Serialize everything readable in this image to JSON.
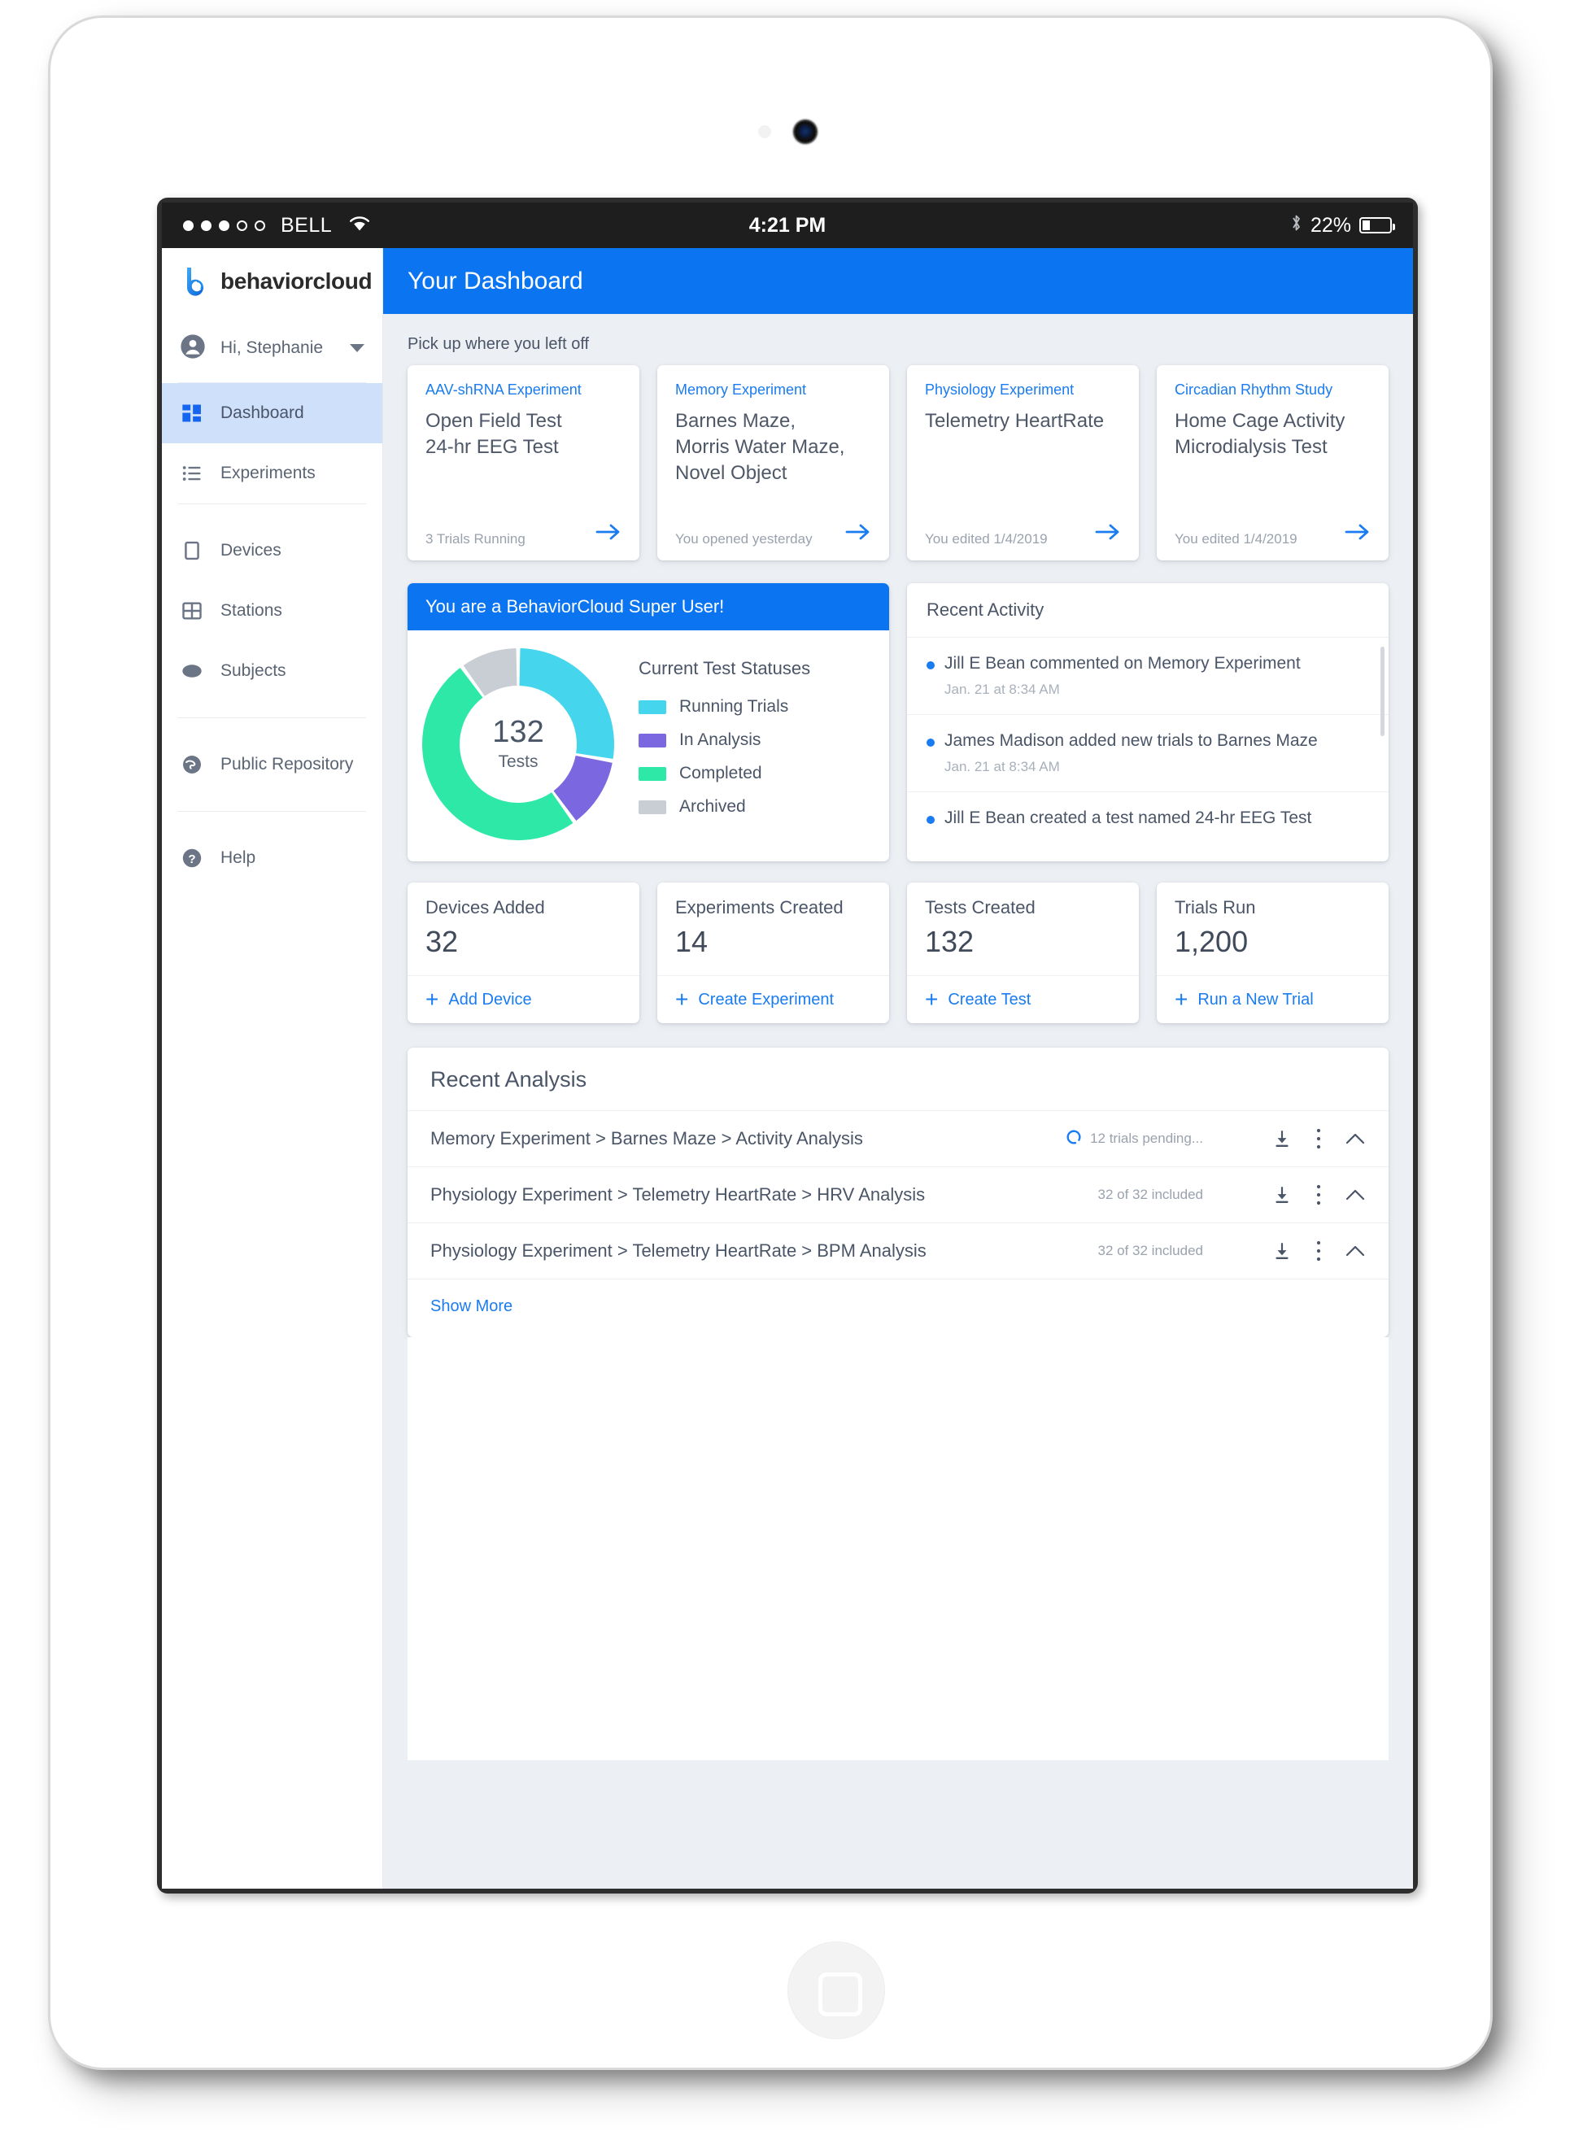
{
  "status_bar": {
    "carrier": "BELL",
    "signal_filled": 3,
    "signal_total": 5,
    "time": "4:21 PM",
    "battery_percent": "22%",
    "bluetooth_icon": "bluetooth-icon",
    "wifi_icon": "wifi-icon"
  },
  "sidebar": {
    "brand": "behaviorcloud",
    "menu_icon": "hamburger-icon",
    "user": {
      "greeting": "Hi, Stephanie",
      "avatar_icon": "account-circle-icon",
      "caret_icon": "chevron-down-icon"
    },
    "items": [
      {
        "label": "Dashboard",
        "icon": "dashboard-grid-icon",
        "active": true
      },
      {
        "label": "Experiments",
        "icon": "list-bullet-icon",
        "active": false
      },
      {
        "label": "Devices",
        "icon": "square-outline-icon",
        "active": false
      },
      {
        "label": "Stations",
        "icon": "grid-table-icon",
        "active": false
      },
      {
        "label": "Subjects",
        "icon": "mouse-ellipse-icon",
        "active": false
      },
      {
        "label": "Public Repository",
        "icon": "globe-icon",
        "active": false
      },
      {
        "label": "Help",
        "icon": "question-circle-icon",
        "active": false
      }
    ]
  },
  "header": {
    "title": "Your Dashboard",
    "accent_color": "#0b74f0"
  },
  "resume": {
    "section_label": "Pick up where you left off",
    "cards": [
      {
        "experiment": "AAV-shRNA Experiment",
        "tests": "Open Field Test\n24-hr EEG Test",
        "meta": "3 Trials Running",
        "arrow_icon": "arrow-right-icon"
      },
      {
        "experiment": "Memory Experiment",
        "tests": "Barnes Maze,\nMorris Water Maze,\nNovel Object",
        "meta": "You opened yesterday",
        "arrow_icon": "arrow-right-icon"
      },
      {
        "experiment": "Physiology Experiment",
        "tests": "Telemetry  HeartRate",
        "meta": "You edited 1/4/2019",
        "arrow_icon": "arrow-right-icon"
      },
      {
        "experiment": "Circadian Rhythm Study",
        "tests": "Home Cage Activity\nMicrodialysis Test",
        "meta": "You edited 1/4/2019",
        "arrow_icon": "arrow-right-icon"
      }
    ]
  },
  "super_user": {
    "banner": "You are a BehaviorCloud Super User!",
    "legend_title": "Current Test Statuses"
  },
  "chart_data": {
    "type": "pie",
    "title": "Current Test Statuses",
    "center_value": "132",
    "center_label": "Tests",
    "total": 132,
    "donut": true,
    "legend_position": "right",
    "categories": [
      "Running Trials",
      "In Analysis",
      "Completed",
      "Archived"
    ],
    "values": [
      37,
      16,
      66,
      13
    ],
    "percentages": [
      28,
      12,
      50,
      10
    ],
    "colors": [
      "#45d5ec",
      "#7b68e0",
      "#2ee8a8",
      "#c9ced5"
    ],
    "start_angle_deg": 0,
    "segments": [
      {
        "name": "Running Trials",
        "value": 37,
        "percent": 28,
        "color": "#45d5ec",
        "start_deg": 0,
        "end_deg": 100
      },
      {
        "name": "In Analysis",
        "value": 16,
        "percent": 12,
        "color": "#7b68e0",
        "start_deg": 100,
        "end_deg": 144
      },
      {
        "name": "Completed",
        "value": 66,
        "percent": 50,
        "color": "#2ee8a8",
        "start_deg": 144,
        "end_deg": 324
      },
      {
        "name": "Archived",
        "value": 13,
        "percent": 10,
        "color": "#c9ced5",
        "start_deg": 324,
        "end_deg": 360
      }
    ]
  },
  "recent_activity": {
    "title": "Recent Activity",
    "items": [
      {
        "text": "Jill E Bean commented on Memory Experiment",
        "time": "Jan. 21 at 8:34 AM"
      },
      {
        "text": "James Madison added new trials to Barnes Maze",
        "time": "Jan. 21 at 8:34 AM"
      },
      {
        "text": "Jill E Bean created a test named 24-hr EEG Test",
        "time": ""
      }
    ]
  },
  "stats": [
    {
      "label": "Devices Added",
      "value": "32",
      "action": "Add Device",
      "action_icon": "plus-icon"
    },
    {
      "label": "Experiments Created",
      "value": "14",
      "action": "Create Experiment",
      "action_icon": "plus-icon"
    },
    {
      "label": "Tests Created",
      "value": "132",
      "action": "Create Test",
      "action_icon": "plus-icon"
    },
    {
      "label": "Trials Run",
      "value": "1,200",
      "action": "Run a New Trial",
      "action_icon": "plus-icon"
    }
  ],
  "recent_analysis": {
    "title": "Recent Analysis",
    "show_more": "Show More",
    "rows": [
      {
        "name": "Memory Experiment > Barnes Maze > Activity Analysis",
        "status": "12 trials pending...",
        "spinner": true,
        "download_icon": "download-icon",
        "menu_icon": "more-vertical-icon",
        "collapse_icon": "chevron-up-icon"
      },
      {
        "name": "Physiology Experiment > Telemetry HeartRate > HRV Analysis",
        "status": "32 of 32 included",
        "spinner": false,
        "download_icon": "download-icon",
        "menu_icon": "more-vertical-icon",
        "collapse_icon": "chevron-up-icon"
      },
      {
        "name": "Physiology Experiment > Telemetry HeartRate > BPM Analysis",
        "status": "32 of 32 included",
        "spinner": false,
        "download_icon": "download-icon",
        "menu_icon": "more-vertical-icon",
        "collapse_icon": "chevron-up-icon"
      }
    ]
  }
}
